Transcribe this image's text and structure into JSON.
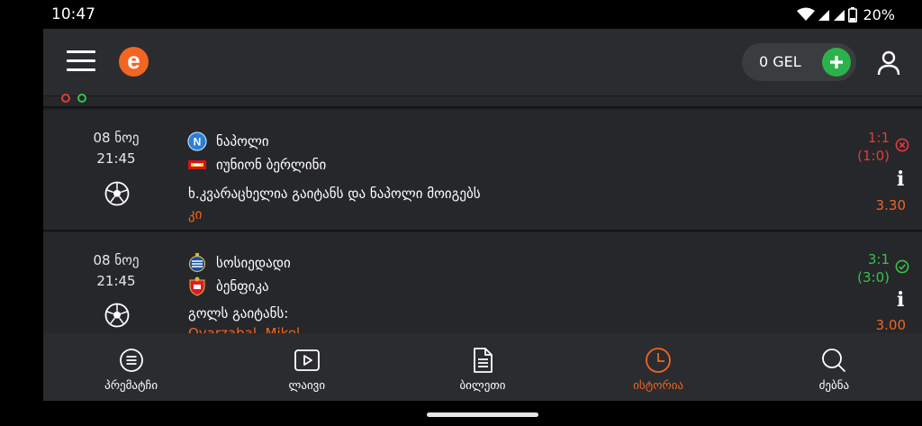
{
  "statusbar": {
    "time": "10:47",
    "battery_text": "20%",
    "icons": [
      "wifi-icon",
      "signal-icon",
      "signal-icon",
      "battery-icon"
    ]
  },
  "header": {
    "logo_letter": "e",
    "balance": "0 GEL",
    "colors": {
      "brand": "#f26522",
      "add": "#2bb24c"
    }
  },
  "bets": [
    {
      "date": "08 ნოე",
      "time": "21:45",
      "home": "ნაპოლი",
      "away": "იუნიონ ბერლინი",
      "market": "ხ.კვარაცხელია გაიტანს და ნაპოლი მოიგებს",
      "pick": "კი",
      "score": "1:1",
      "halftime": "(1:0)",
      "status": "lost",
      "status_color": "#e23b3b",
      "odds": "3.30"
    },
    {
      "date": "08 ნოე",
      "time": "21:45",
      "home": "სოსიედადი",
      "away": "ბენფიკა",
      "market": "გოლს გაიტანს:",
      "pick": "Oyarzabal, Mikel",
      "score": "3:1",
      "halftime": "(3:0)",
      "status": "won",
      "status_color": "#37c24a",
      "odds": "3.00"
    }
  ],
  "nav": {
    "items": [
      {
        "label": "პრემატჩი",
        "icon": "prematch-icon",
        "active": false
      },
      {
        "label": "ლაივი",
        "icon": "live-play-icon",
        "active": false
      },
      {
        "label": "ბილეთი",
        "icon": "ticket-icon",
        "active": false
      },
      {
        "label": "ისტორია",
        "icon": "history-clock-icon",
        "active": true
      },
      {
        "label": "ძებნა",
        "icon": "search-icon",
        "active": false
      }
    ]
  }
}
